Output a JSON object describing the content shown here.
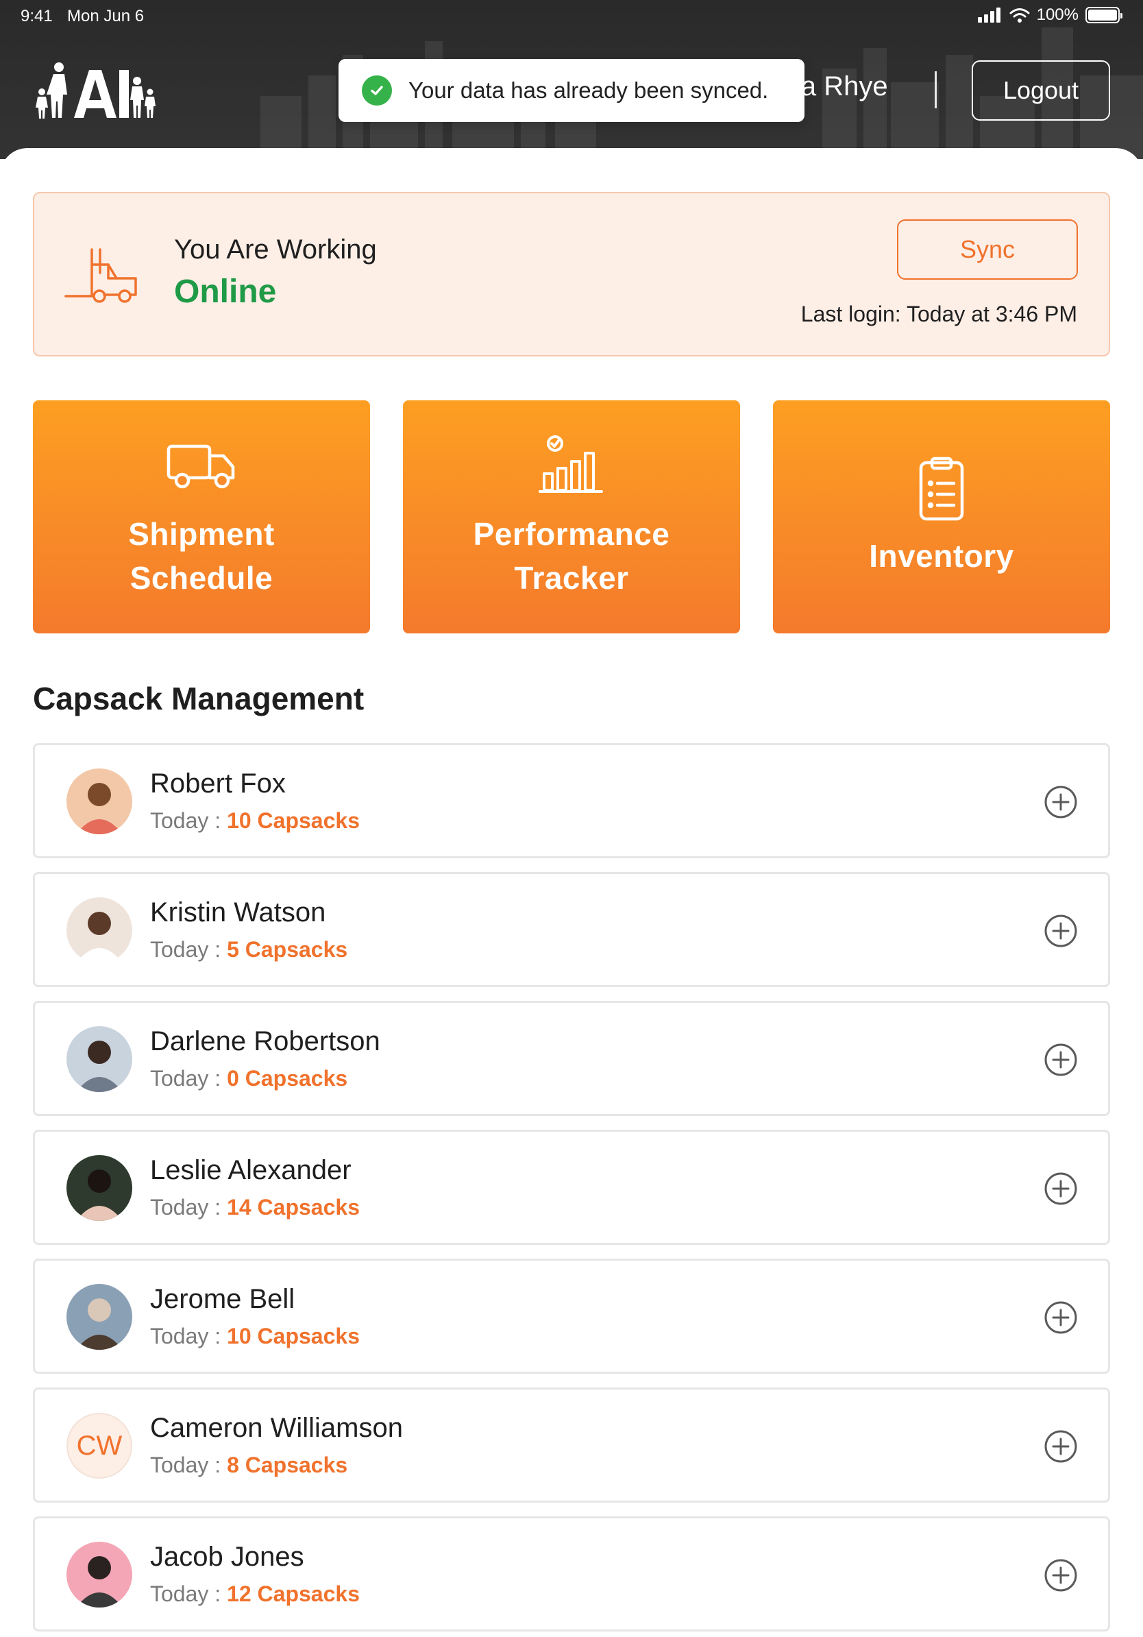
{
  "status_bar": {
    "time": "9:41",
    "date": "Mon Jun 6",
    "battery": "100%"
  },
  "header": {
    "user_name": "ia Rhye",
    "logout_label": "Logout"
  },
  "toast": {
    "message": "Your data has already been synced."
  },
  "status_panel": {
    "working_label": "You Are Working",
    "status": "Online",
    "sync_label": "Sync",
    "last_login": "Last login: Today at 3:46 PM"
  },
  "tiles": [
    {
      "label": "Shipment\nSchedule",
      "icon": "truck-icon"
    },
    {
      "label": "Performance\nTracker",
      "icon": "bar-chart-icon"
    },
    {
      "label": "Inventory",
      "icon": "clipboard-list-icon"
    }
  ],
  "section_title": "Capsack Management",
  "people": [
    {
      "name": "Robert Fox",
      "day": "Today :",
      "count": "10 Capsacks",
      "avatar": "photo"
    },
    {
      "name": "Kristin Watson",
      "day": "Today :",
      "count": "5 Capsacks",
      "avatar": "photo"
    },
    {
      "name": "Darlene Robertson",
      "day": "Today :",
      "count": "0 Capsacks",
      "avatar": "photo"
    },
    {
      "name": "Leslie Alexander",
      "day": "Today :",
      "count": "14 Capsacks",
      "avatar": "photo"
    },
    {
      "name": "Jerome Bell",
      "day": "Today :",
      "count": "10 Capsacks",
      "avatar": "photo"
    },
    {
      "name": "Cameron Williamson",
      "day": "Today :",
      "count": "8 Capsacks",
      "avatar": "initials",
      "initials": "CW"
    },
    {
      "name": "Jacob Jones",
      "day": "Today :",
      "count": "12 Capsacks",
      "avatar": "photo"
    }
  ],
  "colors": {
    "accent": "#f0722c",
    "online": "#1f9a46",
    "tile_top": "#fd9f22",
    "tile_bottom": "#f47a2c",
    "header_bg": "#2e2e2e"
  }
}
